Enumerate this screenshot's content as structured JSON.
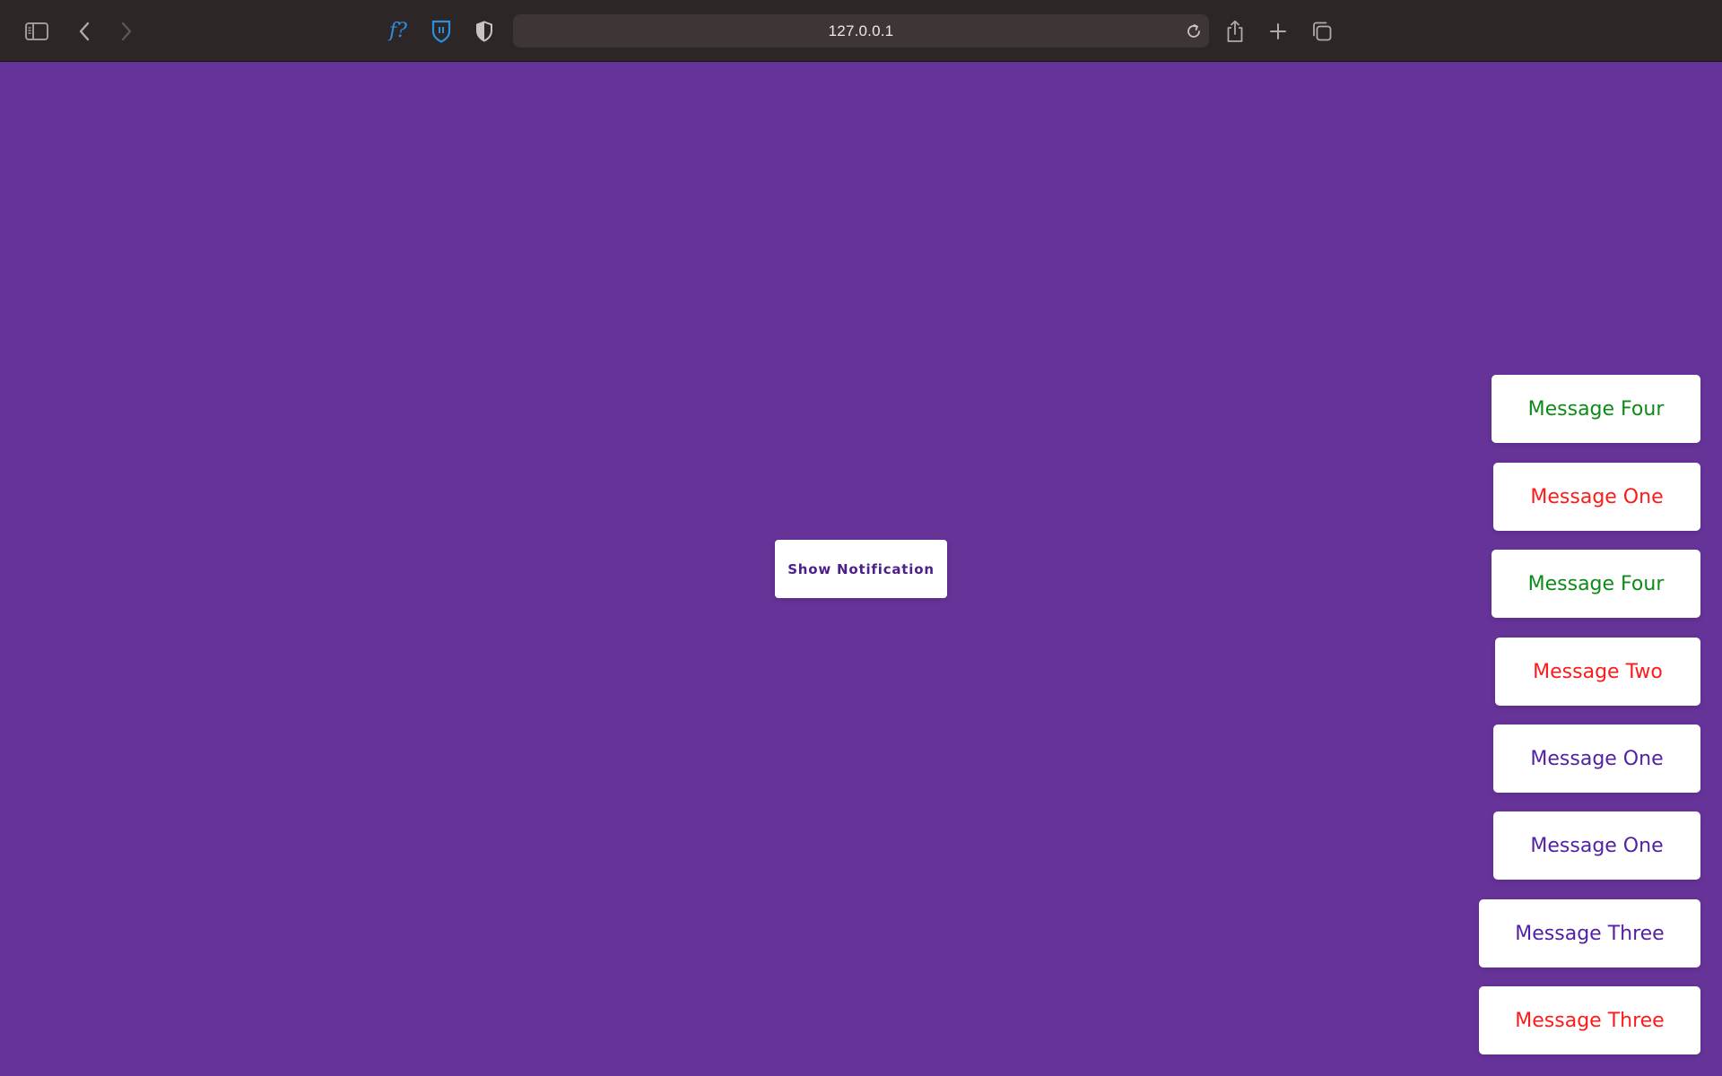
{
  "browser": {
    "url": "127.0.0.1",
    "icons": [
      "sidebar-icon",
      "back-icon",
      "forward-icon",
      "fakespot-icon",
      "bitwarden-icon",
      "privacy-shield-icon",
      "reload-icon",
      "share-icon",
      "new-tab-icon",
      "tabs-overview-icon"
    ],
    "extension_label": "f?"
  },
  "page": {
    "background": "#663399",
    "show_button_label": "Show Notification"
  },
  "notifications": [
    {
      "text": "Message Four",
      "color": "green"
    },
    {
      "text": "Message One",
      "color": "red"
    },
    {
      "text": "Message Four",
      "color": "green"
    },
    {
      "text": "Message Two",
      "color": "red"
    },
    {
      "text": "Message One",
      "color": "purple"
    },
    {
      "text": "Message One",
      "color": "purple"
    },
    {
      "text": "Message Three",
      "color": "purple"
    },
    {
      "text": "Message Three",
      "color": "red"
    }
  ],
  "colors": {
    "green": "#0d8a17",
    "red": "#ff1a1a",
    "purple": "#5321a6"
  }
}
